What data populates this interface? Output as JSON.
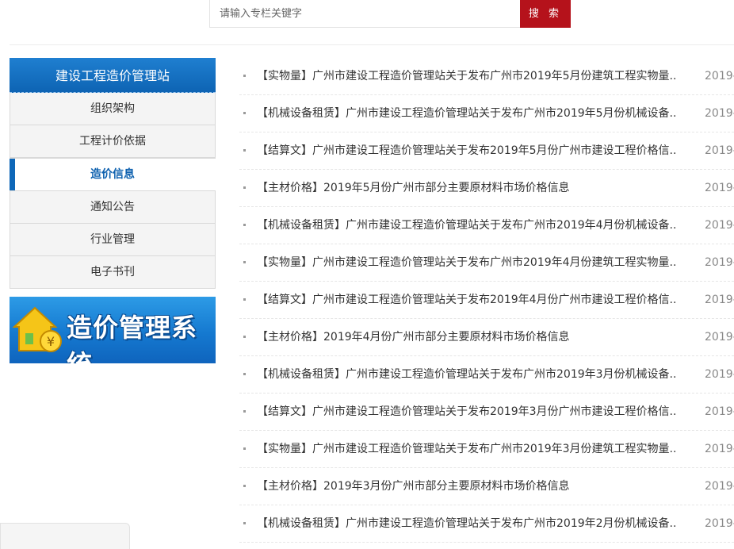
{
  "search": {
    "placeholder": "请输入专栏关键字",
    "button_label": "搜 索"
  },
  "sidebar": {
    "title": "建设工程造价管理站",
    "items": [
      {
        "label": "组织架构",
        "active": false
      },
      {
        "label": "工程计价依据",
        "active": false
      },
      {
        "label": "造价信息",
        "active": true
      },
      {
        "label": "通知公告",
        "active": false
      },
      {
        "label": "行业管理",
        "active": false
      },
      {
        "label": "电子书刊",
        "active": false
      }
    ],
    "banner_text": "造价管理系统"
  },
  "colors": {
    "accent": "#0e67b8",
    "search_button": "#b5121b"
  },
  "list": [
    {
      "title": "【实物量】广州市建设工程造价管理站关于发布广州市2019年5月份建筑工程实物量...",
      "date": "2019-"
    },
    {
      "title": "【机械设备租赁】广州市建设工程造价管理站关于发布广州市2019年5月份机械设备...",
      "date": "2019-"
    },
    {
      "title": "【结算文】广州市建设工程造价管理站关于发布2019年5月份广州市建设工程价格信...",
      "date": "2019-"
    },
    {
      "title": "【主材价格】2019年5月份广州市部分主要原材料市场价格信息",
      "date": "2019-"
    },
    {
      "title": "【机械设备租赁】广州市建设工程造价管理站关于发布广州市2019年4月份机械设备...",
      "date": "2019-"
    },
    {
      "title": "【实物量】广州市建设工程造价管理站关于发布广州市2019年4月份建筑工程实物量...",
      "date": "2019-"
    },
    {
      "title": "【结算文】广州市建设工程造价管理站关于发布2019年4月份广州市建设工程价格信...",
      "date": "2019-"
    },
    {
      "title": "【主材价格】2019年4月份广州市部分主要原材料市场价格信息",
      "date": "2019-"
    },
    {
      "title": "【机械设备租赁】广州市建设工程造价管理站关于发布广州市2019年3月份机械设备...",
      "date": "2019-"
    },
    {
      "title": "【结算文】广州市建设工程造价管理站关于发布2019年3月份广州市建设工程价格信...",
      "date": "2019-"
    },
    {
      "title": "【实物量】广州市建设工程造价管理站关于发布广州市2019年3月份建筑工程实物量...",
      "date": "2019-"
    },
    {
      "title": "【主材价格】2019年3月份广州市部分主要原材料市场价格信息",
      "date": "2019-"
    },
    {
      "title": "【机械设备租赁】广州市建设工程造价管理站关于发布广州市2019年2月份机械设备...",
      "date": "2019-"
    }
  ]
}
